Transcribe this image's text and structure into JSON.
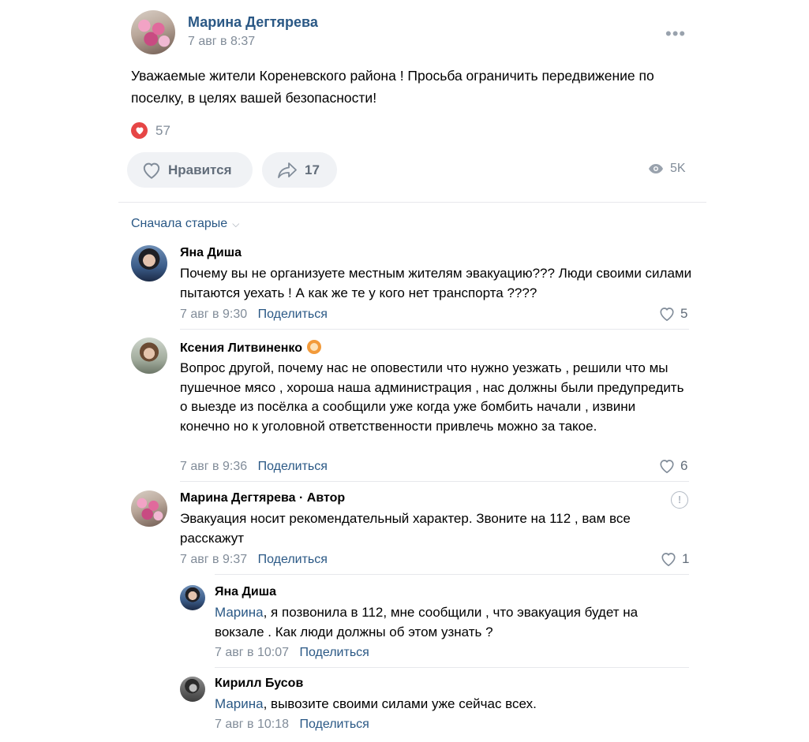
{
  "post": {
    "author": "Марина Дегтярева",
    "date": "7 авг в 8:37",
    "text": "Уважаемые жители Кореневского района ! Просьба ограничить передвижение по поселку, в целях вашей безопасности!",
    "reactions_count": "57",
    "like_label": "Нравится",
    "share_count": "17",
    "views": "5K"
  },
  "comments": {
    "sort_label": "Сначала старые",
    "share_label": "Поделиться",
    "items": [
      {
        "author": "Яна Диша",
        "text": "Почему вы не организуете местным жителям эвакуацию??? Люди своими силами пытаются уехать ! А как же те у кого нет транспорта ????",
        "date": "7 авг в 9:30",
        "likes": "5"
      },
      {
        "author": "Ксения Литвиненко",
        "text": "Вопрос другой, почему нас не оповестили что нужно уезжать , решили что мы пушечное мясо , хороша наша администрация , нас должны были предупредить о выезде из посёлка а сообщили уже когда уже бомбить начали , извини конечно но к уголовной ответственности привлечь можно за такое.",
        "date": "7 авг в 9:36",
        "likes": "6"
      },
      {
        "author": "Марина Дегтярева · Автор",
        "text": "Эвакуация носит рекомендательный характер. Звоните на 112 , вам все расскажут",
        "date": "7 авг в 9:37",
        "likes": "1"
      }
    ],
    "replies": [
      {
        "author": "Яна Диша",
        "mention": "Марина",
        "text": ", я позвонила в 112, мне сообщили , что эвакуация будет на вокзале . Как люди должны об этом узнать ?",
        "date": "7 авг в 10:07"
      },
      {
        "author": "Кирилл Бусов",
        "mention": "Марина",
        "text": ", вывозите своими силами уже сейчас всех.",
        "date": "7 авг в 10:18"
      }
    ]
  },
  "icons": {
    "more": "more-dots-icon",
    "heart": "heart-icon",
    "share": "share-arrow-icon",
    "views": "eye-icon",
    "chevron": "chevron-down-icon",
    "report": "report-icon",
    "donut_badge": "donut-badge-icon"
  },
  "colors": {
    "link": "#2a5885",
    "secondary_text": "#818c99",
    "pill_bg": "#f0f2f5",
    "reaction_red": "#e64646"
  }
}
